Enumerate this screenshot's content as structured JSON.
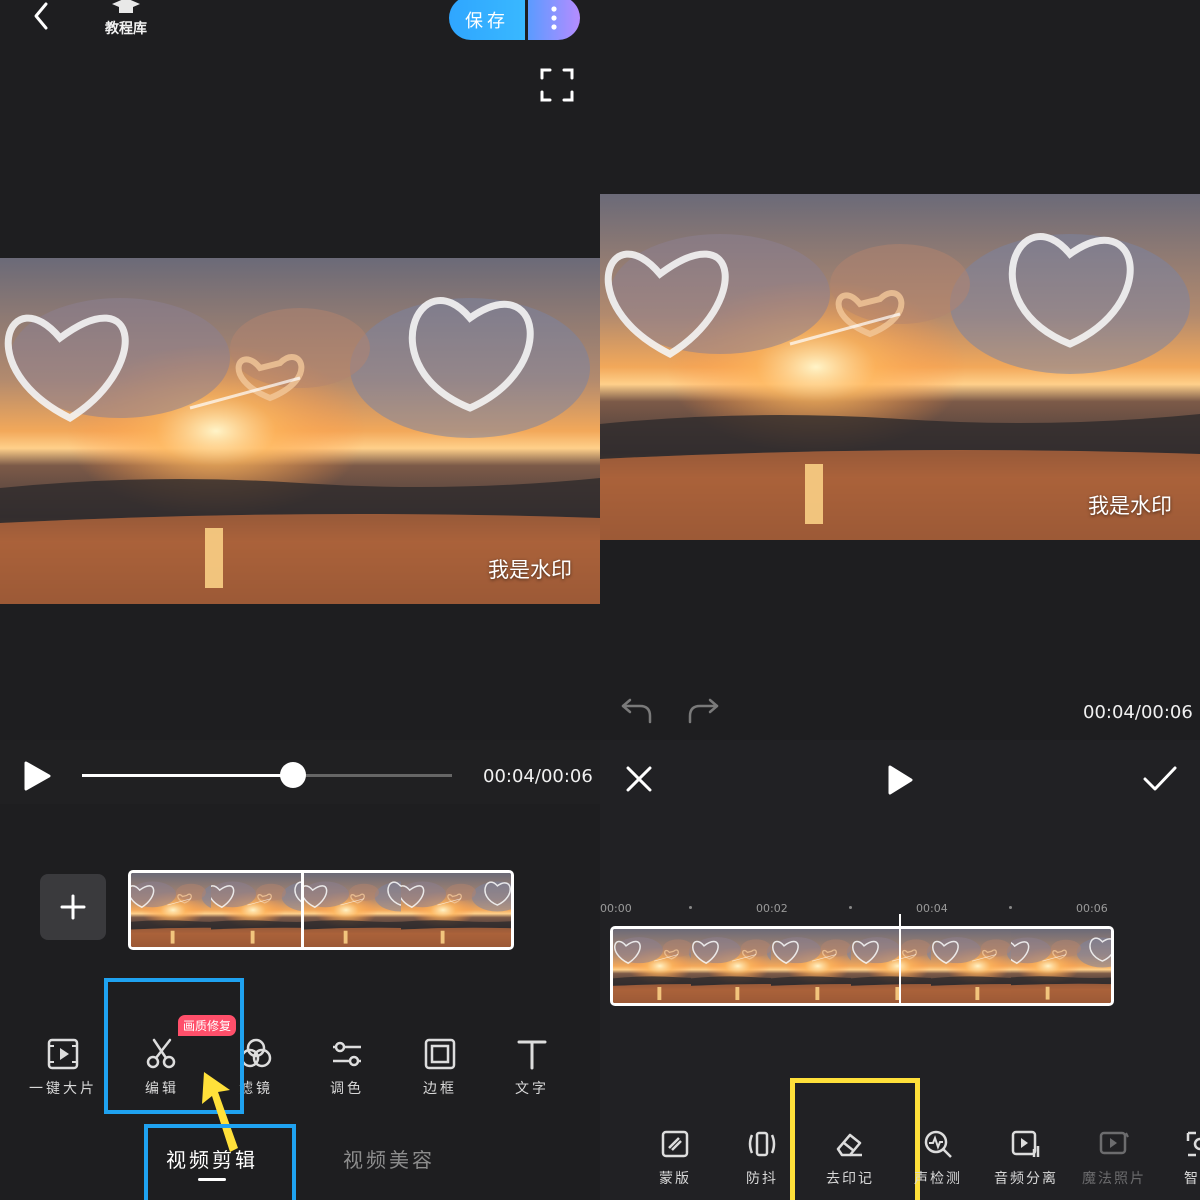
{
  "left": {
    "header": {
      "tutorial_label": "教程库",
      "save_label": "保存"
    },
    "video": {
      "watermark": "我是水印"
    },
    "playback": {
      "time": "00:04/00:06",
      "progress": 0.57
    },
    "toolbar": {
      "badge": "画质修复",
      "items": [
        {
          "label": "一键大片",
          "icon": "film-icon"
        },
        {
          "label": "编辑",
          "icon": "scissors-icon"
        },
        {
          "label": "滤镜",
          "icon": "filter-circles-icon"
        },
        {
          "label": "调色",
          "icon": "sliders-icon"
        },
        {
          "label": "边框",
          "icon": "frame-icon"
        },
        {
          "label": "文字",
          "icon": "text-icon"
        }
      ]
    },
    "tabs": [
      {
        "label": "视频剪辑",
        "active": true
      },
      {
        "label": "视频美容",
        "active": false
      }
    ]
  },
  "right": {
    "video": {
      "watermark": "我是水印"
    },
    "time": "00:04/00:06",
    "ruler": [
      "00:00",
      "00:02",
      "00:04",
      "00:06"
    ],
    "toolbar": {
      "items": [
        {
          "label": "蒙版",
          "icon": "mask-icon"
        },
        {
          "label": "防抖",
          "icon": "stabilize-icon"
        },
        {
          "label": "去印记",
          "icon": "eraser-icon"
        },
        {
          "label": "声检测",
          "icon": "audio-detect-icon"
        },
        {
          "label": "音频分离",
          "icon": "audio-separate-icon"
        },
        {
          "label": "魔法照片",
          "icon": "magic-photo-icon"
        },
        {
          "label": "智能",
          "icon": "smart-icon"
        }
      ]
    }
  },
  "colors": {
    "highlight_blue": "#1fa2f0",
    "highlight_yellow": "#ffe03a",
    "arrow_yellow": "#ffe03a",
    "badge": "#ff4f6a"
  }
}
